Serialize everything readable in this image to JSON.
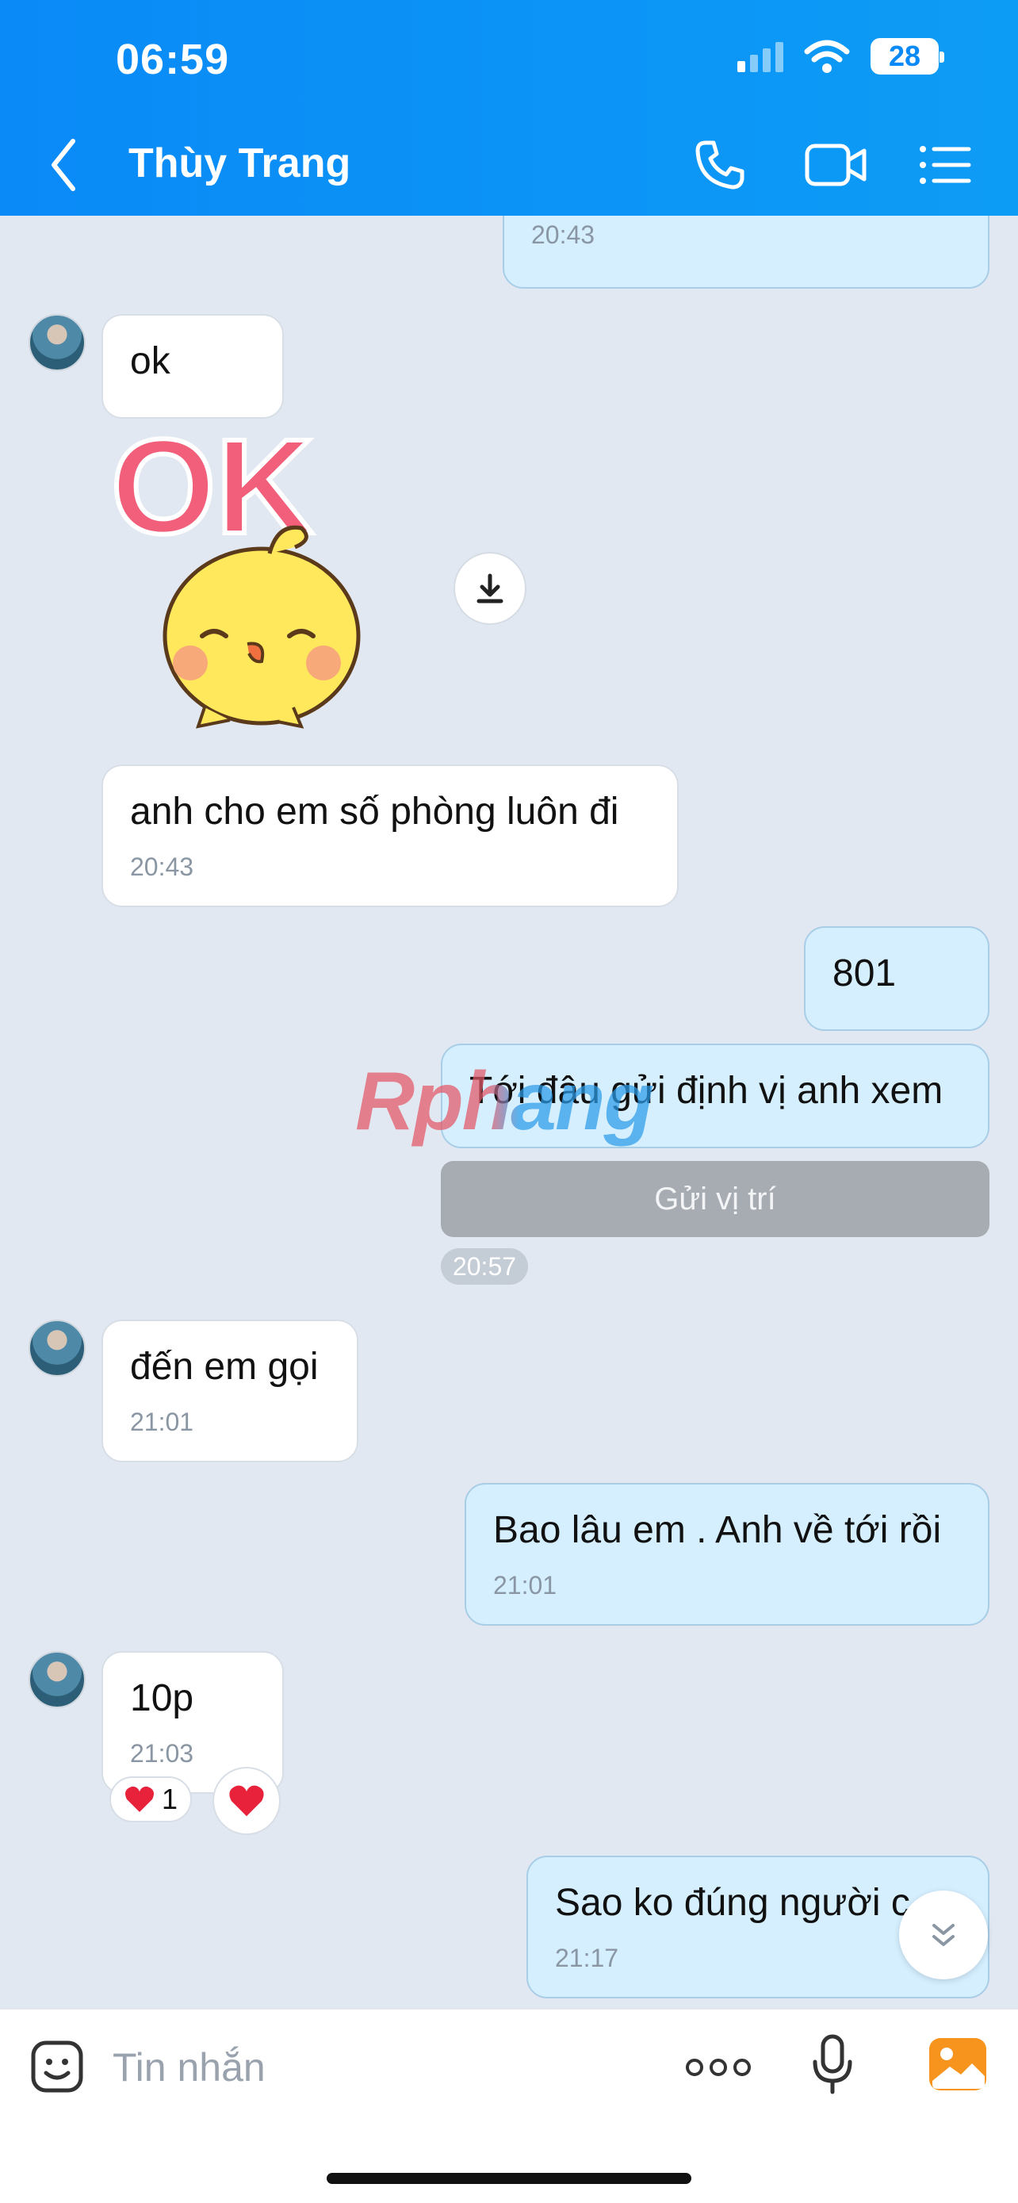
{
  "status_bar": {
    "time": "06:59",
    "battery": "28"
  },
  "header": {
    "contact_name": "Thùy Trang"
  },
  "messages": {
    "top_out_time": "20:43",
    "m_ok": "ok",
    "m_room": "anh cho em số phòng luôn đi",
    "m_room_time": "20:43",
    "m_801": "801",
    "m_location_req": "Tới đâu gửi định vị anh xem",
    "m_send_location": "Gửi vị trí",
    "m_location_time": "20:57",
    "m_arrive": "đến em gọi",
    "m_arrive_time": "21:01",
    "m_howlong": "Bao lâu em . Anh về tới rồi",
    "m_howlong_time": "21:01",
    "m_10p": "10p",
    "m_10p_time": "21:03",
    "m_10p_reaction_count": "1",
    "m_last": "Sao ko đúng người c",
    "m_last_time": "21:17"
  },
  "sticker": {
    "text": "OK"
  },
  "watermark": {
    "text": "Rphang"
  },
  "input": {
    "placeholder": "Tin nhắn"
  },
  "colors": {
    "header": "#0a8af7",
    "outgoing": "#d5efff",
    "incoming": "#ffffff",
    "chat_bg": "#e2e8f1",
    "heart": "#e8223a"
  }
}
